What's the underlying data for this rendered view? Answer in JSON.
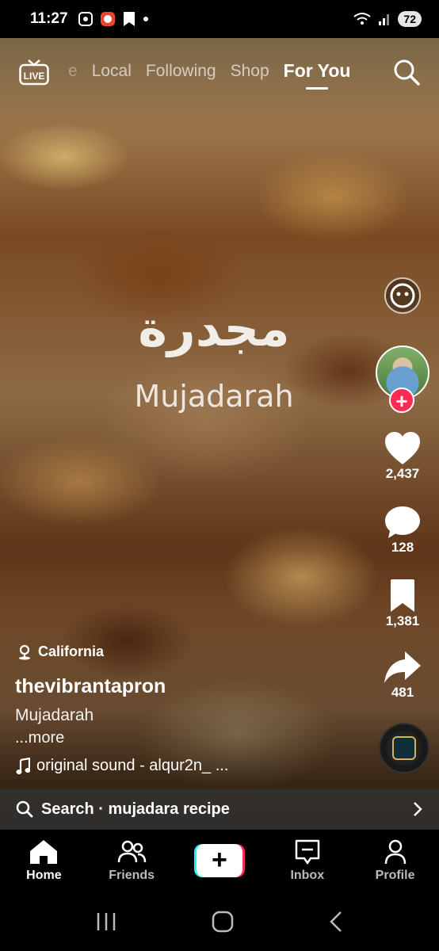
{
  "status_bar": {
    "time": "11:27",
    "battery": "72"
  },
  "top_nav": {
    "live_label": "LIVE",
    "tabs": [
      {
        "label": "e"
      },
      {
        "label": "Local"
      },
      {
        "label": "Following"
      },
      {
        "label": "Shop"
      },
      {
        "label": "For You"
      }
    ]
  },
  "video": {
    "title_arabic": "مجدرة",
    "title_latin": "Mujadarah"
  },
  "rail": {
    "likes": "2,437",
    "comments": "128",
    "saves": "1,381",
    "shares": "481"
  },
  "post": {
    "location": "California",
    "username": "thevibrantapron",
    "caption": "Mujadarah",
    "more": "...more",
    "sound": "original sound - alqur2n_ ..."
  },
  "search_suggestion": {
    "text": "Search · mujadara recipe"
  },
  "bottom_nav": {
    "home": "Home",
    "friends": "Friends",
    "inbox": "Inbox",
    "profile": "Profile"
  },
  "colors": {
    "accent_red": "#fe2c55",
    "accent_cyan": "#25f4ee"
  }
}
